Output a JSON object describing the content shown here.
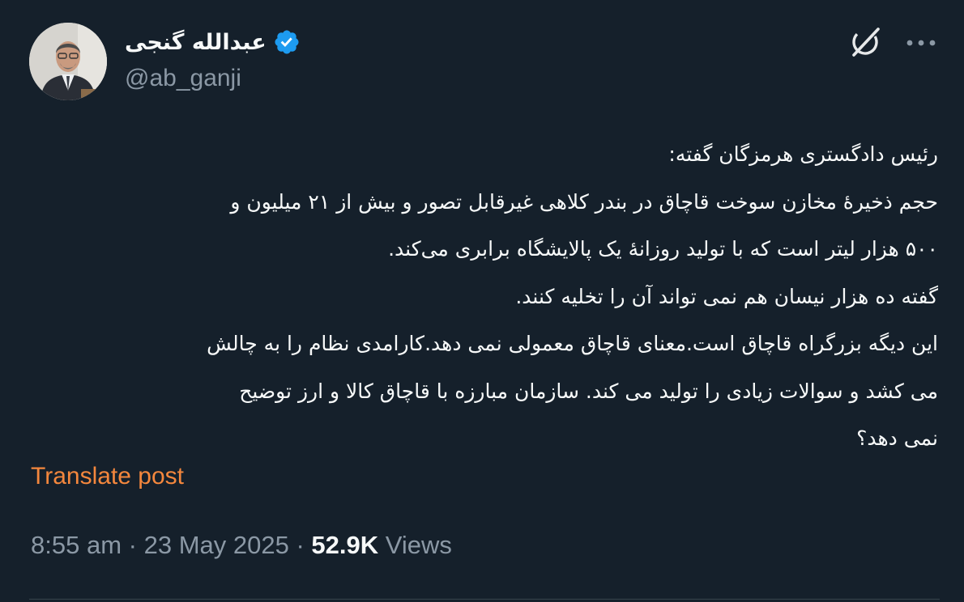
{
  "author": {
    "display_name": "عبدالله گنجی",
    "handle": "@ab_ganji",
    "verified": true
  },
  "icons": {
    "avatar": "profile-photo",
    "verified": "verified-badge-icon",
    "grok": "grok-icon",
    "more": "more-options-icon"
  },
  "tweet": {
    "lines": [
      "رئیس دادگستری هرمزگان گفته:",
      "حجم ذخیرهٔ مخازن سوخت قاچاق در بندر کلاهی غیرقابل تصور و بیش از ۲۱ میلیون و",
      "۵۰۰ هزار لیتر است که با تولید روزانهٔ یک پالایشگاه برابری می‌کند.",
      "گفته ده هزار نیسان هم نمی تواند آن را تخلیه کنند.",
      "این دیگه بزرگراه قاچاق است.معنای قاچاق معمولی نمی دهد.کارامدی نظام را به چالش",
      "می کشد و سوالات زیادی را تولید می کند. سازمان مبارزه با قاچاق کالا و ارز  توضیح",
      "نمی دهد؟"
    ]
  },
  "translate_label": "Translate post",
  "meta": {
    "time": "8:55 am",
    "separator": "·",
    "date": "23 May 2025",
    "views_count": "52.9K",
    "views_label": "Views"
  },
  "colors": {
    "background": "#15202b",
    "text": "#f7f9f9",
    "secondary": "#8b98a5",
    "accent": "#f4873d",
    "verified": "#1d9bf0"
  }
}
